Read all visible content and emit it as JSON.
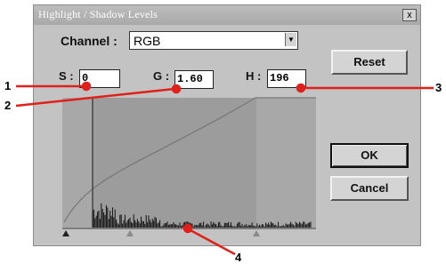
{
  "dialog": {
    "title": "Highlight / Shadow Levels",
    "close_label": "x"
  },
  "channel": {
    "label": "Channel :",
    "value": "RGB",
    "arrow_icon": "chevron-down-icon"
  },
  "levels": {
    "s_label": "S :",
    "s_value": "0",
    "g_label": "G :",
    "g_value": "1.60",
    "h_label": "H :",
    "h_value": "196"
  },
  "buttons": {
    "reset": "Reset",
    "ok": "OK",
    "cancel": "Cancel"
  },
  "callouts": {
    "one": "1",
    "two": "2",
    "three": "3",
    "four": "4",
    "color": "#e0201a"
  },
  "histogram": {
    "shadow_level": 0,
    "gamma": 1.6,
    "highlight_level": 196
  }
}
